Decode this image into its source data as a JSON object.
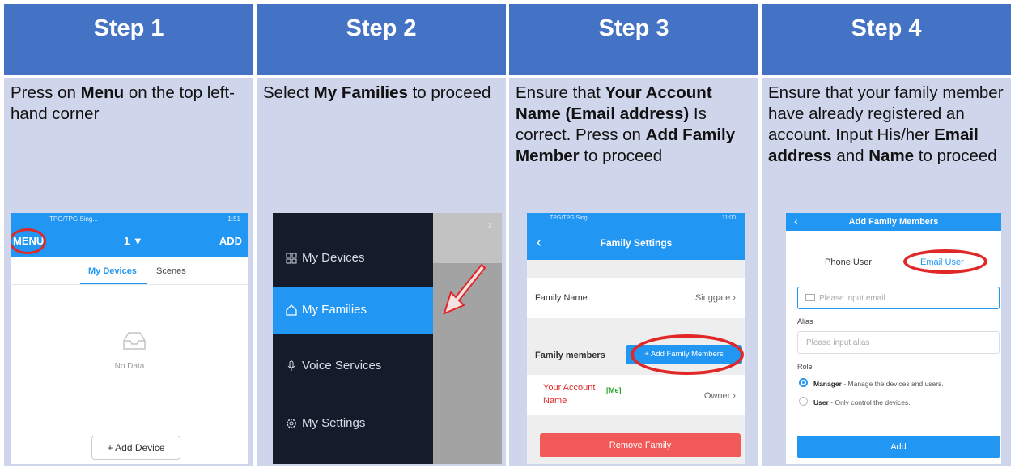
{
  "steps": [
    {
      "header": "Step 1",
      "desc_parts": [
        "Press on ",
        "Menu",
        " on the top left-hand  corner"
      ]
    },
    {
      "header": "Step 2",
      "desc_parts": [
        "Select ",
        "My Families",
        " to proceed"
      ]
    },
    {
      "header": "Step 3",
      "desc_parts": [
        "Ensure that ",
        "Your Account Name (Email address)",
        " Is correct. Press on ",
        "Add Family Member",
        " to proceed"
      ]
    },
    {
      "header": "Step 4",
      "desc_parts": [
        "Ensure that your family member have already registered an account. Input His/her ",
        "Email address",
        " and ",
        "Name",
        " to proceed"
      ]
    }
  ],
  "colors": {
    "header": "#4472c4",
    "panel": "#cfd5ea",
    "app_blue": "#2196f3",
    "highlight_red": "#e02828"
  },
  "step1": {
    "status_left": "TPG/TPG Sing...",
    "status_right": "1:51",
    "menu": "MENU",
    "selector": "1 ▼",
    "add": "ADD",
    "tab_devices": "My Devices",
    "tab_scenes": "Scenes",
    "no_data": "No Data",
    "add_device": "+ Add Device"
  },
  "step2": {
    "items": [
      {
        "label": "My Devices",
        "icon": "grid-icon"
      },
      {
        "label": "My Families",
        "icon": "home-icon"
      },
      {
        "label": "Voice Services",
        "icon": "mic-icon"
      },
      {
        "label": "My Settings",
        "icon": "gear-icon"
      }
    ]
  },
  "step3": {
    "status_left": "TPG/TPG Sing...",
    "status_right": "11:00",
    "title": "Family Settings",
    "family_name_label": "Family Name",
    "family_name_value": "Singgate",
    "members_label": "Family members",
    "add_members": "+  Add Family Members",
    "account_name": "Your Account Name",
    "me": "[Me]",
    "owner": "Owner",
    "remove": "Remove Family"
  },
  "step4": {
    "title": "Add Family Members",
    "phone_user": "Phone User",
    "email_user": "Email User",
    "email_placeholder": "Please input email",
    "alias_label": "Alias",
    "alias_placeholder": "Please input alias",
    "role_label": "Role",
    "manager": "Manager",
    "manager_desc": " - Manage the devices and users.",
    "user": "User",
    "user_desc": " - Only control the devices.",
    "add": "Add"
  }
}
